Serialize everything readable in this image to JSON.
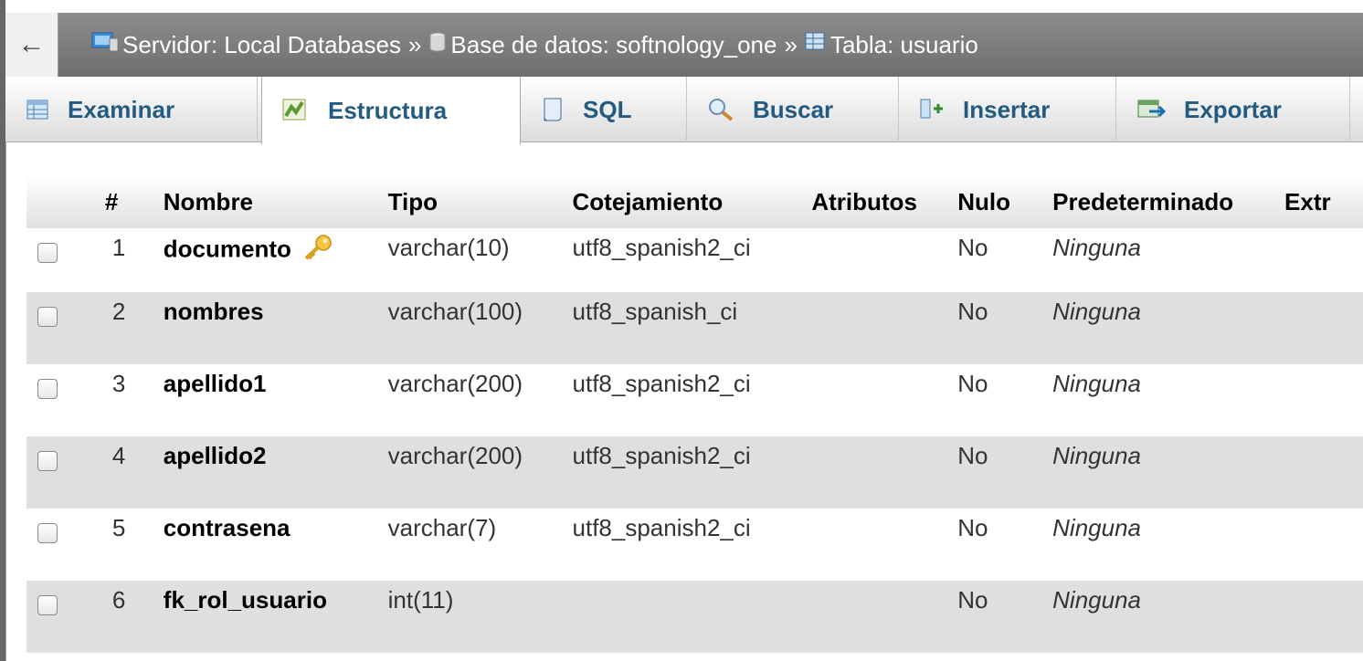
{
  "breadcrumb": {
    "back_icon": "arrow-left-icon",
    "server_label": "Servidor: Local Databases",
    "sep1": "»",
    "db_label": "Base de datos: softnology_one",
    "sep2": "»",
    "table_label": "Tabla: usuario"
  },
  "tabs": [
    {
      "label": "Examinar",
      "icon": "browse-table-icon"
    },
    {
      "label": "Estructura",
      "icon": "structure-icon",
      "active": true
    },
    {
      "label": "SQL",
      "icon": "sql-icon"
    },
    {
      "label": "Buscar",
      "icon": "search-icon"
    },
    {
      "label": "Insertar",
      "icon": "insert-icon"
    },
    {
      "label": "Exportar",
      "icon": "export-icon"
    }
  ],
  "table": {
    "headers": [
      "#",
      "Nombre",
      "Tipo",
      "Cotejamiento",
      "Atributos",
      "Nulo",
      "Predeterminado",
      "Extr"
    ],
    "rows": [
      {
        "num": "1",
        "name": "documento",
        "type": "varchar(10)",
        "collation": "utf8_spanish2_ci",
        "attributes": "",
        "null": "No",
        "default": "Ninguna",
        "primary_key": true
      },
      {
        "num": "2",
        "name": "nombres",
        "type": "varchar(100)",
        "collation": "utf8_spanish_ci",
        "attributes": "",
        "null": "No",
        "default": "Ninguna"
      },
      {
        "num": "3",
        "name": "apellido1",
        "type": "varchar(200)",
        "collation": "utf8_spanish2_ci",
        "attributes": "",
        "null": "No",
        "default": "Ninguna"
      },
      {
        "num": "4",
        "name": "apellido2",
        "type": "varchar(200)",
        "collation": "utf8_spanish2_ci",
        "attributes": "",
        "null": "No",
        "default": "Ninguna"
      },
      {
        "num": "5",
        "name": "contrasena",
        "type": "varchar(7)",
        "collation": "utf8_spanish2_ci",
        "attributes": "",
        "null": "No",
        "default": "Ninguna"
      },
      {
        "num": "6",
        "name": "fk_rol_usuario",
        "type": "int(11)",
        "collation": "",
        "attributes": "",
        "null": "No",
        "default": "Ninguna"
      }
    ]
  },
  "colors": {
    "tab_text": "#235a81",
    "topbar_bg": "#7a7a7a",
    "even_row": "#dfdfdf"
  }
}
